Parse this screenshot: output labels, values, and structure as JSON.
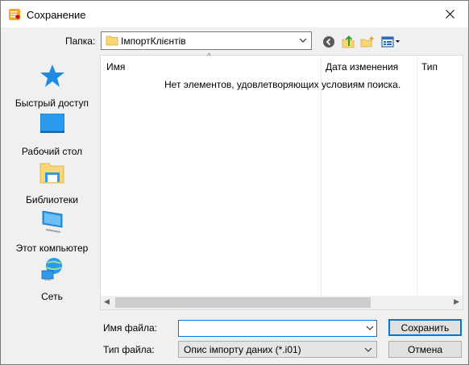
{
  "window": {
    "title": "Сохранение",
    "close_icon": "close-icon"
  },
  "location": {
    "label": "Папка:",
    "current": "ІмпортКлієнтів"
  },
  "toolbar": {
    "icons": [
      "back-icon",
      "up-folder-icon",
      "new-folder-icon",
      "view-menu-icon"
    ]
  },
  "places": [
    {
      "label": "Быстрый доступ",
      "icon": "star-icon"
    },
    {
      "label": "Рабочий стол",
      "icon": "desktop-icon"
    },
    {
      "label": "Библиотеки",
      "icon": "libraries-icon"
    },
    {
      "label": "Этот компьютер",
      "icon": "computer-icon"
    },
    {
      "label": "Сеть",
      "icon": "network-icon"
    }
  ],
  "filelist": {
    "columns": [
      "Имя",
      "Дата изменения",
      "Тип"
    ],
    "empty_message": "Нет элементов, удовлетворяющих условиям поиска."
  },
  "form": {
    "filename_label": "Имя файла:",
    "filename_value": "",
    "filetype_label": "Тип файла:",
    "filetype_value": "Опис імпорту даних (*.i01)"
  },
  "buttons": {
    "save": "Сохранить",
    "cancel": "Отмена"
  },
  "colors": {
    "accent": "#0078d7",
    "star": "#1e8ae0",
    "folder": "#f8d775"
  }
}
